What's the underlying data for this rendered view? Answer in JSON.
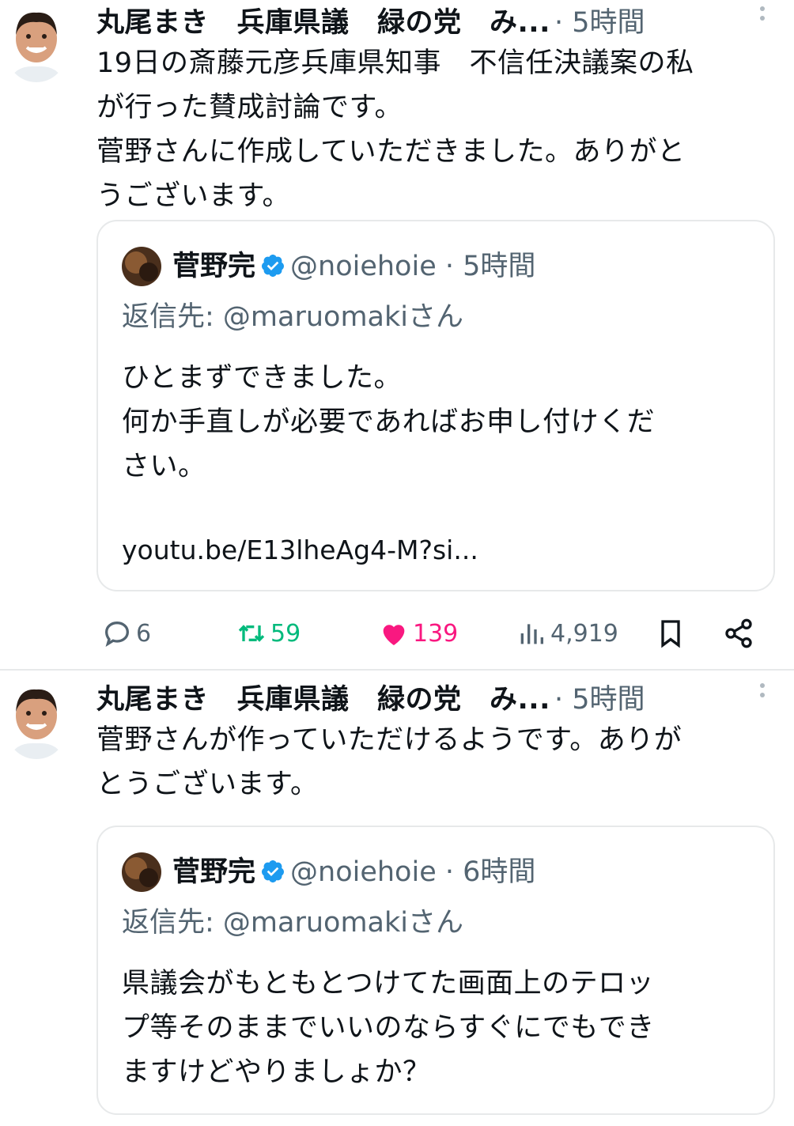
{
  "posts": [
    {
      "author": "丸尾まき　兵庫県議　緑の党　み...",
      "time": "· 5時間",
      "body_lines": [
        "19日の斎藤元彦兵庫県知事　不信任決議案の私",
        "が行った賛成討論です。",
        "菅野さんに作成していただきました。ありがと",
        "うございます。"
      ],
      "quote": {
        "name": "菅野完",
        "handle": "@noiehoie",
        "time": "· 5時間",
        "reply_to": "返信先: @maruomakiさん",
        "text_lines": [
          "ひとまずできました。",
          "何か手直しが必要であればお申し付けくだ",
          "さい。"
        ],
        "link": "youtu.be/E13lheAg4-M?si..."
      },
      "actions": {
        "replies": "6",
        "retweets": "59",
        "likes": "139",
        "views": "4,919"
      }
    },
    {
      "author": "丸尾まき　兵庫県議　緑の党　み...",
      "time": "· 5時間",
      "body_lines": [
        "菅野さんが作っていただけるようです。ありが",
        "とうございます。"
      ],
      "quote": {
        "name": "菅野完",
        "handle": "@noiehoie",
        "time": "· 6時間",
        "reply_to": "返信先: @maruomakiさん",
        "text_lines": [
          "県議会がもともとつけてた画面上のテロッ",
          "プ等そのままでいいのならすぐにでもでき",
          "ますけどやりましょか？"
        ]
      }
    }
  ],
  "colors": {
    "accent_verified": "#1d9bf0",
    "retweet": "#00ba7c",
    "like": "#f91880",
    "muted": "#536471"
  }
}
